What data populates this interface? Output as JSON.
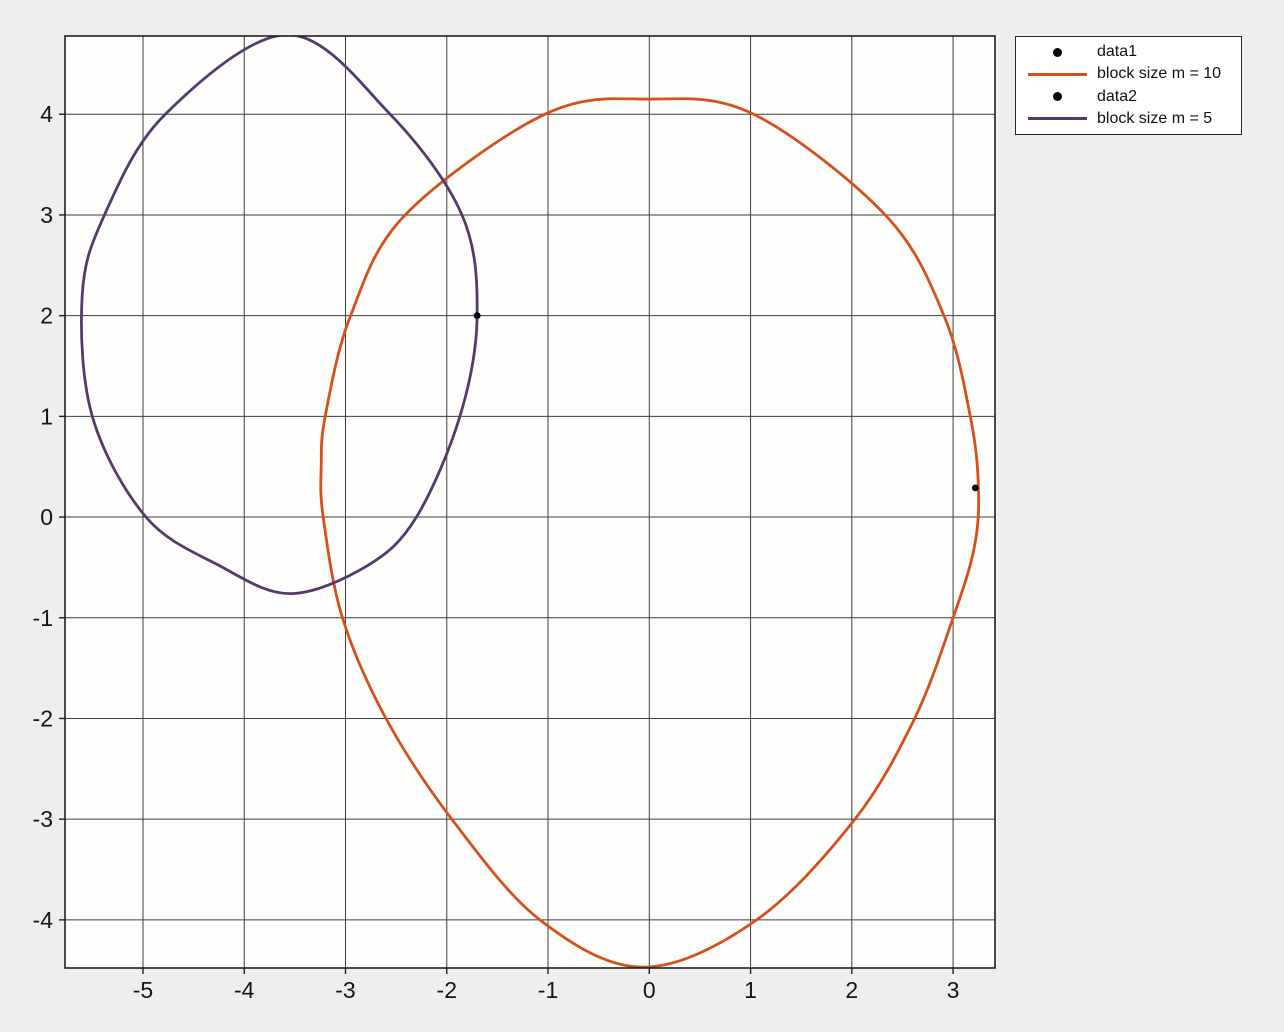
{
  "window": {
    "background_color": "#efeeec"
  },
  "chart_data": {
    "type": "line",
    "title": "",
    "xlabel": "",
    "ylabel": "",
    "xlim": [
      -5.77,
      3.414
    ],
    "ylim": [
      -4.478,
      4.777
    ],
    "xticks": [
      -5,
      -4,
      -3,
      -2,
      -1,
      0,
      1,
      2,
      3
    ],
    "yticks": [
      -4,
      -3,
      -2,
      -1,
      0,
      1,
      2,
      3,
      4
    ],
    "grid": true,
    "axes_background": "#fdfdfc",
    "grid_color": "#3c3c3c",
    "box_color": "#1f1f1f",
    "tick_label_color": "#151515",
    "series": [
      {
        "name": "data1",
        "type": "scatter",
        "marker": "dot",
        "color": "#000000",
        "points": [
          [
            3.22,
            0.29
          ]
        ]
      },
      {
        "name": "block size m = 10",
        "type": "closed_curve",
        "color": "#d4501d",
        "points": [
          [
            0.0,
            4.15
          ],
          [
            1.03,
            4.0
          ],
          [
            2.33,
            3.0
          ],
          [
            2.91,
            2.0
          ],
          [
            3.17,
            1.0
          ],
          [
            3.25,
            0.3
          ],
          [
            3.21,
            -0.3
          ],
          [
            3.0,
            -1.0
          ],
          [
            2.62,
            -2.0
          ],
          [
            2.03,
            -3.0
          ],
          [
            1.06,
            -4.0
          ],
          [
            -0.06,
            -4.47
          ],
          [
            -1.08,
            -4.0
          ],
          [
            -1.95,
            -3.0
          ],
          [
            -2.6,
            -2.0
          ],
          [
            -3.03,
            -1.0
          ],
          [
            -3.22,
            0.0
          ],
          [
            -3.24,
            0.5
          ],
          [
            -3.2,
            1.0
          ],
          [
            -2.95,
            2.0
          ],
          [
            -2.41,
            3.0
          ],
          [
            -1.03,
            4.0
          ]
        ]
      },
      {
        "name": "data2",
        "type": "scatter",
        "marker": "dot",
        "color": "#000000",
        "points": [
          [
            -1.7,
            2.0
          ]
        ]
      },
      {
        "name": "block size m = 5",
        "type": "closed_curve",
        "color": "#543a69",
        "points": [
          [
            -3.57,
            4.79
          ],
          [
            -2.56,
            4.0
          ],
          [
            -1.85,
            3.0
          ],
          [
            -1.7,
            2.0
          ],
          [
            -1.87,
            1.0
          ],
          [
            -2.3,
            0.0
          ],
          [
            -2.78,
            -0.48
          ],
          [
            -3.55,
            -0.76
          ],
          [
            -4.25,
            -0.48
          ],
          [
            -4.97,
            0.0
          ],
          [
            -5.5,
            1.0
          ],
          [
            -5.6,
            2.2
          ],
          [
            -5.38,
            3.0
          ],
          [
            -4.78,
            4.0
          ]
        ]
      }
    ],
    "legend": {
      "position": "top-right",
      "entries": [
        {
          "label": "data1",
          "marker": "dot",
          "color": "#000000"
        },
        {
          "label": "block size m = 10",
          "marker": "line",
          "color": "#d4501d"
        },
        {
          "label": "data2",
          "marker": "dot",
          "color": "#000000"
        },
        {
          "label": "block size m = 5",
          "marker": "line",
          "color": "#543a69"
        }
      ]
    }
  }
}
